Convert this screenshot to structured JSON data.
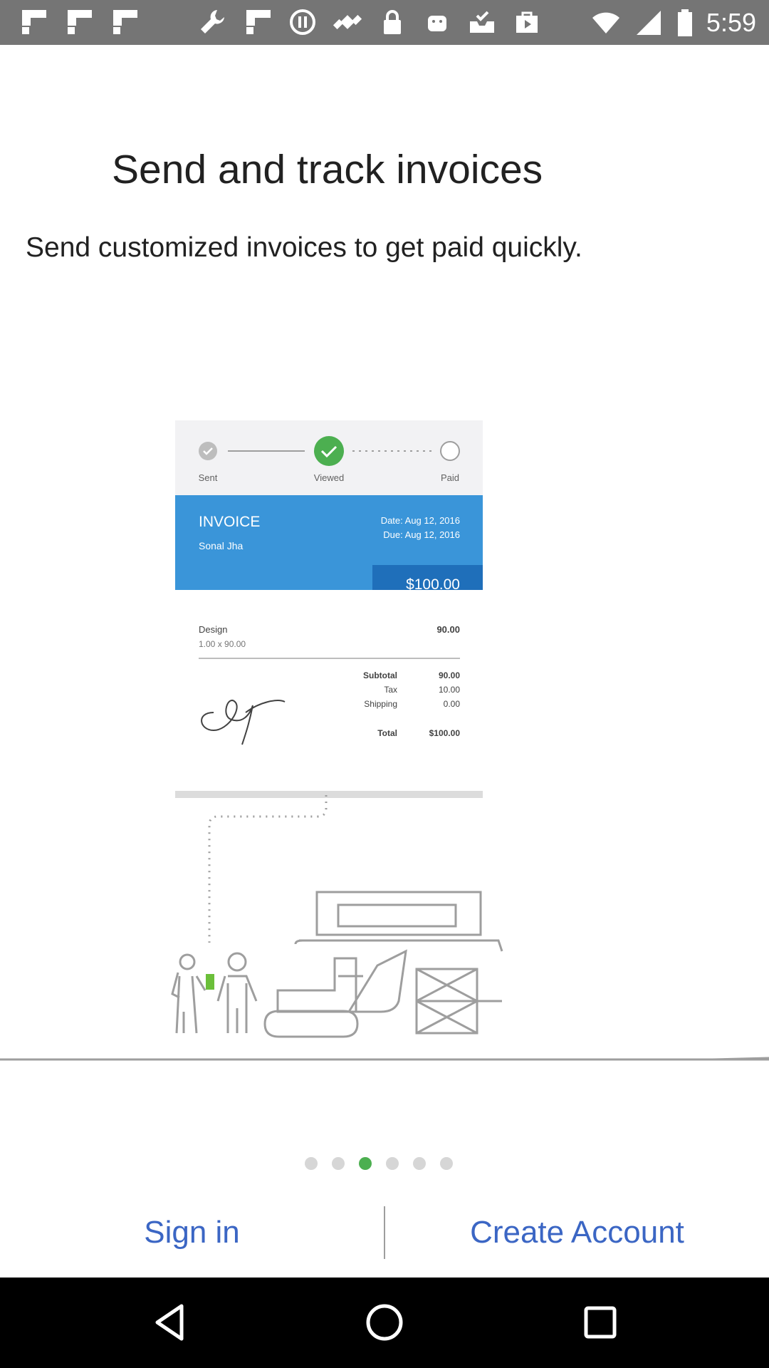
{
  "status_bar": {
    "time": "5:59",
    "icons": [
      "flipboard-icon",
      "flipboard-icon",
      "flipboard-icon",
      "wrench-icon",
      "flipboard-icon",
      "circle-pause-icon",
      "satellite-fake-gps-icon",
      "lock-icon",
      "android-icon",
      "inbox-check-icon",
      "play-store-icon"
    ]
  },
  "onboarding": {
    "title": "Send and track invoices",
    "subtitle": "Send customized invoices to get paid quickly."
  },
  "invoice_card": {
    "steps": [
      "Sent",
      "Viewed",
      "Paid"
    ],
    "heading": "INVOICE",
    "customer": "Sonal Jha",
    "date": "Date: Aug 12, 2016",
    "due": "Due: Aug 12, 2016",
    "amount": "$100.00",
    "item_name": "Design",
    "item_detail": "1.00 x 90.00",
    "item_amount": "90.00",
    "subtotal_label": "Subtotal",
    "subtotal_value": "90.00",
    "tax_label": "Tax",
    "tax_value": "10.00",
    "shipping_label": "Shipping",
    "shipping_value": "0.00",
    "total_label": "Total",
    "total_value": "$100.00",
    "accent_color": "#3a95d9",
    "step_color": "#4caf50"
  },
  "pager": {
    "count": 6,
    "active_index": 2
  },
  "actions": {
    "sign_in": "Sign in",
    "create_account": "Create Account"
  },
  "nav_bar": {
    "back": "back-icon",
    "home": "home-icon",
    "recents": "recents-icon"
  }
}
